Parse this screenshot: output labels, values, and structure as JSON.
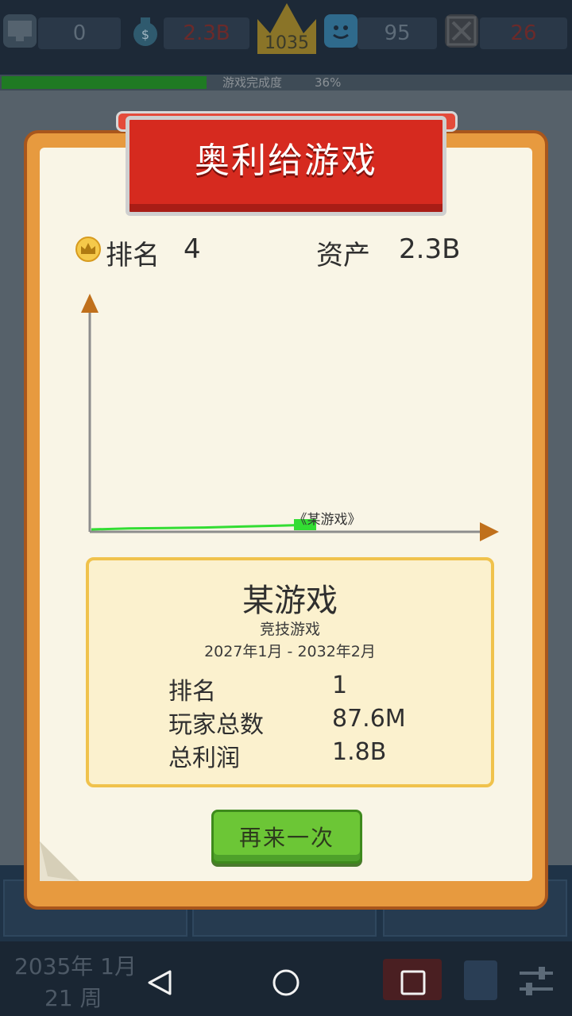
{
  "hud": {
    "stat1_value": "0",
    "money_value": "2.3B",
    "crown_value": "1035",
    "fans_value": "95",
    "stat5_value": "26",
    "progress_label": "游戏完成度",
    "progress_value": "36%",
    "progress_fraction": 0.36
  },
  "dialog": {
    "title": "奥利给游戏",
    "rank_label": "排名",
    "rank_value": "4",
    "assets_label": "资产",
    "assets_value": "2.3B"
  },
  "chart_data": {
    "type": "line",
    "series": [
      {
        "name": "《某游戏》",
        "x": [
          0,
          1,
          2,
          3,
          4,
          5,
          6
        ],
        "values": [
          0,
          0.2,
          0.3,
          0.4,
          0.6,
          0.8,
          1.0
        ]
      }
    ],
    "label": "《某游戏》",
    "grid": false
  },
  "game_card": {
    "name": "某游戏",
    "genre": "竞技游戏",
    "period": "2027年1月 - 2032年2月",
    "rows": [
      {
        "label": "排名",
        "value": "1"
      },
      {
        "label": "玩家总数",
        "value": "87.6M"
      },
      {
        "label": "总利润",
        "value": "1.8B"
      }
    ]
  },
  "retry_button": {
    "label": "再来一次"
  },
  "footer": {
    "date_line1": "2035年 1月",
    "date_line2": "21 周"
  },
  "colors": {
    "dialog_frame": "#e79a3f",
    "title_red": "#d62a1f",
    "button_green": "#6cc636",
    "chart_line": "#33dd33",
    "arrow": "#c0701c"
  },
  "icons": [
    "monitor-icon",
    "money-bag-icon",
    "crown-icon",
    "fan-face-icon",
    "error-icon",
    "back-icon",
    "home-icon",
    "recent-apps-icon",
    "book-icon",
    "settings-sliders-icon",
    "rank-medal-icon"
  ]
}
